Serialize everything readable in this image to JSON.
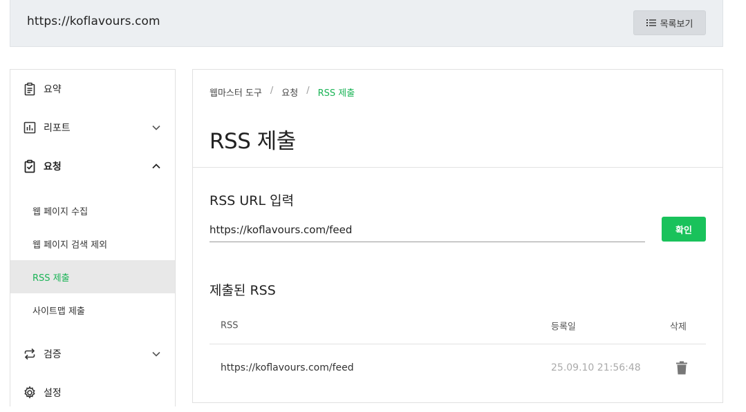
{
  "header": {
    "site_url": "https://koflavours.com",
    "list_button_label": "목록보기"
  },
  "sidebar": {
    "items": [
      {
        "label": "요약",
        "icon": "clipboard-icon"
      },
      {
        "label": "리포트",
        "icon": "chart-icon"
      },
      {
        "label": "요청",
        "icon": "clipboard-check-icon"
      },
      {
        "label": "검증",
        "icon": "repeat-icon"
      },
      {
        "label": "설정",
        "icon": "gear-icon"
      }
    ],
    "sub_items": [
      {
        "label": "웹 페이지 수집"
      },
      {
        "label": "웹 페이지 검색 제외"
      },
      {
        "label": "RSS 제출"
      },
      {
        "label": "사이트맵 제출"
      }
    ]
  },
  "breadcrumb": {
    "items": [
      "웹마스터 도구",
      "요청",
      "RSS 제출"
    ],
    "separator": "/"
  },
  "main": {
    "title": "RSS 제출",
    "input_section_label": "RSS URL 입력",
    "rss_input_value": "https://koflavours.com/feed",
    "confirm_label": "확인",
    "submitted_section_label": "제출된 RSS",
    "table": {
      "headers": [
        "RSS",
        "등록일",
        "삭제"
      ],
      "rows": [
        {
          "rss": "https://koflavours.com/feed",
          "date": "25.09.10 21:56:48"
        }
      ]
    }
  },
  "colors": {
    "accent": "#19c25b",
    "active_text": "#19b355",
    "topbar_bg": "#eceff2"
  }
}
